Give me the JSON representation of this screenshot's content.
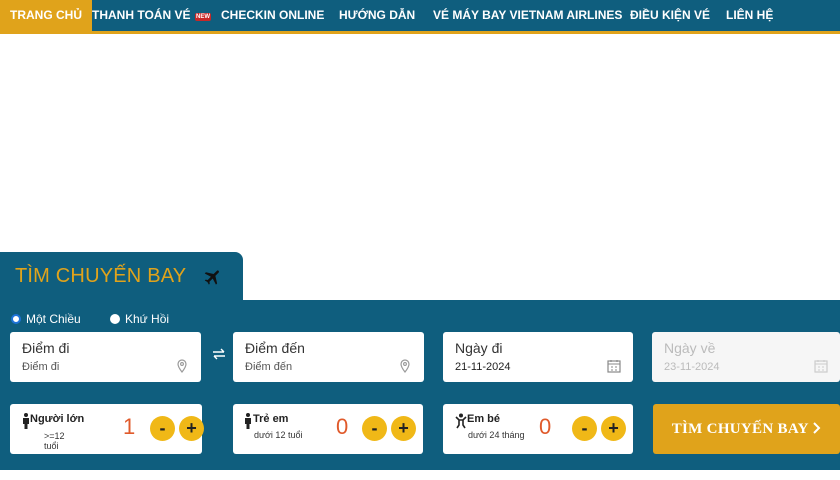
{
  "nav": {
    "items": [
      {
        "label": "TRANG CHỦ"
      },
      {
        "label": "THANH TOÁN VÉ"
      },
      {
        "label": "CHECKIN ONLINE",
        "badge": "NEW"
      },
      {
        "label": "HƯỚNG DẪN"
      },
      {
        "label": "VÉ MÁY BAY VIETNAM AIRLINES"
      },
      {
        "label": "ĐIỀU KIỆN VÉ"
      },
      {
        "label": "LIÊN HỆ"
      }
    ]
  },
  "search": {
    "title": "TÌM CHUYẾN BAY",
    "trip_types": [
      {
        "label": "Một Chiều",
        "selected": true
      },
      {
        "label": "Khứ Hồi",
        "selected": false
      }
    ],
    "from": {
      "label": "Điểm đi",
      "placeholder": "Điểm đi"
    },
    "to": {
      "label": "Điểm đến",
      "placeholder": "Điểm đến"
    },
    "depart": {
      "label": "Ngày đi",
      "value": "21-11-2024"
    },
    "return": {
      "label": "Ngày về",
      "value": "23-11-2024"
    },
    "passengers": [
      {
        "label": "Người lớn",
        "sub1": ">=12",
        "sub2": "tuổi",
        "count": "1"
      },
      {
        "label": "Trẻ em",
        "sub1": "dưới 12 tuổi",
        "count": "0"
      },
      {
        "label": "Em bé",
        "sub1": "dưới 24 tháng",
        "count": "0"
      }
    ],
    "minus": "-",
    "plus": "+",
    "submit": "TÌM CHUYẾN BAY"
  },
  "colors": {
    "primary": "#0f5e7e",
    "accent": "#e0a31b",
    "count": "#e05a2b"
  }
}
